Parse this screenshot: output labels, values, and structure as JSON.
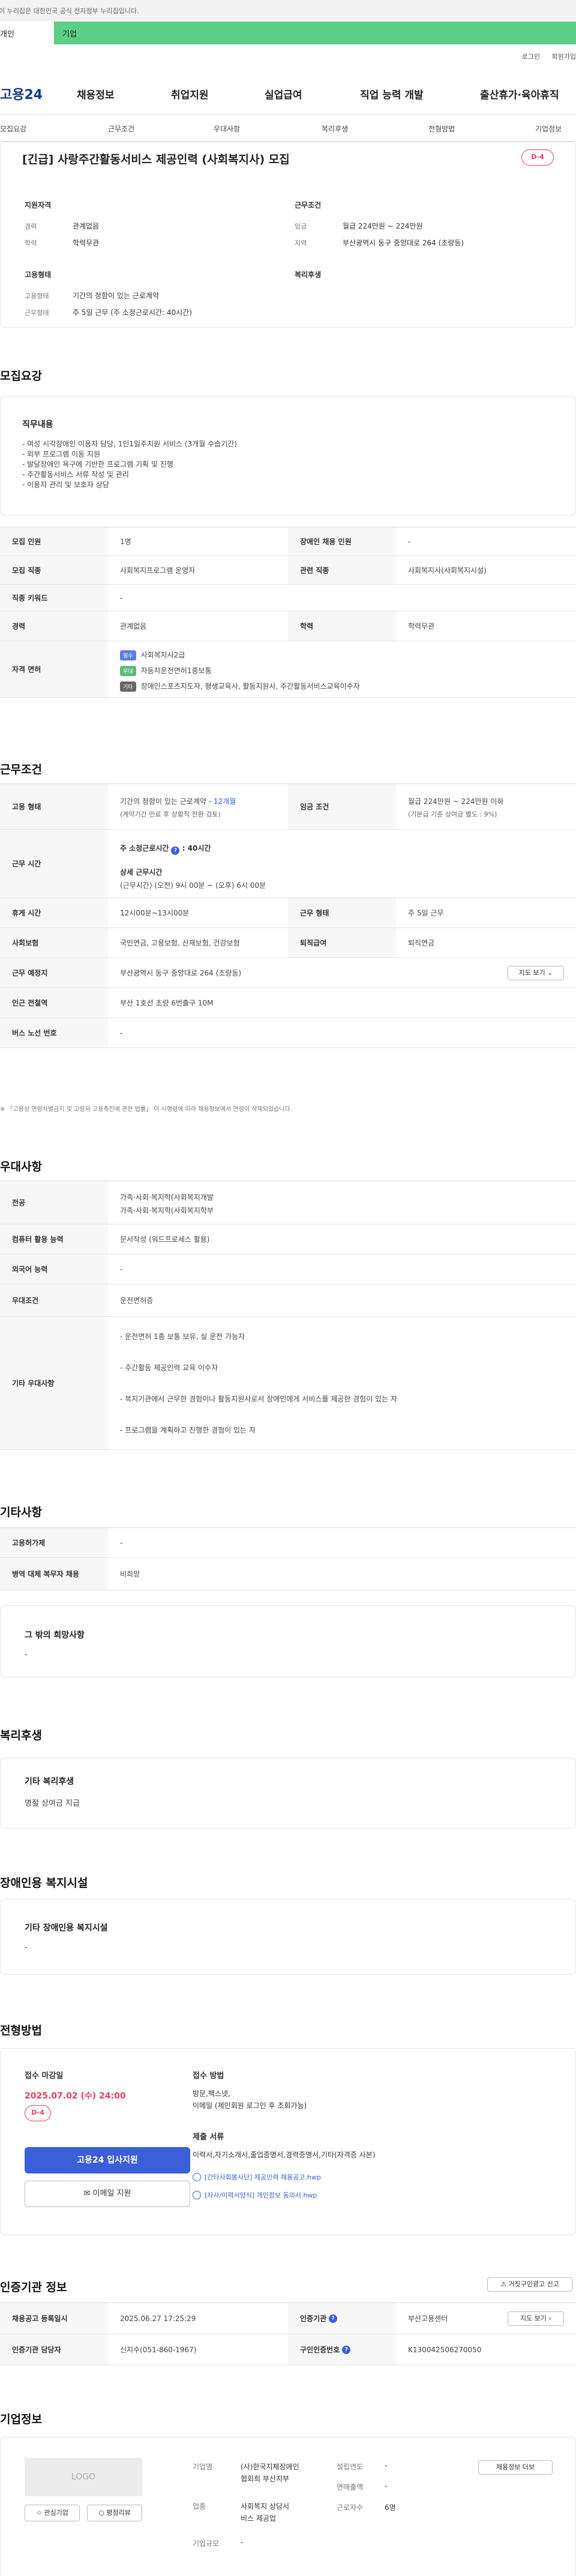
{
  "gov_banner": "이 누리집은 대한민국 공식 전자정부 누리집입니다.",
  "site_switch": {
    "personal": "개인",
    "company": "기업"
  },
  "util": {
    "login": "로그인",
    "signup": "회원가입"
  },
  "site": {
    "logo": "고용24",
    "gnb": [
      "채용정보",
      "취업지원",
      "실업급여",
      "직업 능력 개발",
      "출산휴가·육아휴직"
    ]
  },
  "subnav": [
    "모집요강",
    "근무조건",
    "우대사항",
    "복리후생",
    "전형방법",
    "기업정보"
  ],
  "summary": {
    "title": "[긴급] 사랑주간활동서비스 제공인력 (사회복지사) 모집",
    "dday": "D-4",
    "qualification": {
      "heading": "지원자격",
      "career_label": "경력",
      "career_value": "관계없음",
      "edu_label": "학력",
      "edu_value": "학력무관"
    },
    "conditions": {
      "heading": "근무조건",
      "wage_label": "임금",
      "wage_value": "월급 224만원 ~ 224만원",
      "area_label": "지역",
      "area_value": "부산광역시 동구 중앙대로 264 (초량동)"
    },
    "employment": {
      "heading": "고용형태",
      "type_label": "고용형태",
      "type_value": "기간의 정함이 있는 근로계약",
      "form_label": "근무형태",
      "form_value": "주 5일 근무 (주 소정근로시간: 40시간)"
    },
    "welfare": {
      "heading": "복리후생"
    }
  },
  "recruit": {
    "title": "모집요강",
    "duty_heading": "직무내용",
    "duty_lines": [
      "- 여성 시각장애인 이용자 담당, 1인1일주치원 서비스 (3개월 수습기간)",
      "- 외부 프로그램 이동 지원",
      "- 발달장애인 욕구에 기반한 프로그램 기획 및 진행",
      "- 주간활동서비스 서류 작성 및 관리",
      "- 이용자 관리 및 보호자 상담"
    ],
    "rows": [
      {
        "k1": "모집 인원",
        "v1": "1명",
        "k2": "장애인 채용 인원",
        "v2": "-"
      },
      {
        "k1": "모집 직종",
        "v1": "사회복지프로그램 운영자",
        "k2": "관련 직종",
        "v2": "사회복지사(사회복지시설)"
      },
      {
        "k1": "직종 키워드",
        "v1": "-"
      },
      {
        "k1": "경력",
        "v1": "관계없음",
        "k2": "학력",
        "v2": "학력무관"
      }
    ],
    "license_label": "자격 면허",
    "licenses": [
      {
        "badge": "필수",
        "badge_color": "#5b7ee5",
        "text": "사회복지사2급"
      },
      {
        "badge": "우대",
        "badge_color": "#5dbb84",
        "text": "자동차운전면허1종보통"
      },
      {
        "badge": "기타",
        "badge_color": "#666666",
        "text": "장애인스포츠지도자, 평생교육사, 활동지원사, 주간활동서비스교육이수자"
      }
    ]
  },
  "work": {
    "title": "근무조건",
    "type_label": "고용 형태",
    "type_line1_a": "기간의 정함이 있는 근로계약 - ",
    "type_line1_b": "12개월",
    "type_line2": "(계약기간 만료 후 상황직 전환 검토)",
    "wage_label": "임금 조건",
    "wage_line1": "월급 224만원 ~ 224만원 이하",
    "wage_line2": "(기본급 기준 상여금 별도 : 9%)",
    "hours_label": "근무 시간",
    "hours_weekly": "주 소정근로시간",
    "hours_weekly_value": ": 40시간",
    "hours_detail_heading": "상세 근무시간",
    "hours_detail": "(근무시간) (오전) 9시 00분 ~ (오후) 6시 00분",
    "break_label": "휴게 시간",
    "break_value": "12시00분~13시00분",
    "form_label": "근무 형태",
    "form_value": "주 5일 근무",
    "insurance_label": "사회보험",
    "insurance_value": "국민연금, 고용보험, 산재보험, 건강보험",
    "retire_label": "퇴직급여",
    "retire_value": "퇴직연금",
    "place_label": "근무 예정지",
    "place_value": "부산광역시 동구 중앙대로 264 (초량동)",
    "map_btn": "지도 보기",
    "subway_label": "인근 전철역",
    "subway_value": "부산 1호선 초량 6번출구 10M",
    "bus_label": "버스 노선 번호",
    "bus_value": "-",
    "note": "※ 「고용상 연령차별금지 및 고령자 고용촉진에 관한 법률」 이 시행령에 따라 채용정보에서 연령이 삭제되었습니다."
  },
  "prefer": {
    "title": "우대사항",
    "major_label": "전공",
    "major_lines": [
      "가족·사회·복지학(사회복지개발",
      "가족·사회·복지학(사회복지학부"
    ],
    "computer_label": "컴퓨터 활용 능력",
    "computer_value": "문서작성 (워드프로세스 활용)",
    "lang_label": "외국어 능력",
    "lang_value": "-",
    "cond_label": "우대조건",
    "cond_value": "운전면허증",
    "etc_label": "기타 우대사항",
    "etc_lines": [
      "- 운전면허 1종 보통 보유, 실 운전 가능자",
      "- 주간활동 제공인력 교육 이수자",
      "- 복지기관에서 근무한 경험이나 활동지원사로서 장애인에게 서비스를 제공한 경험이 있는 자",
      "- 프로그램을 계획하고 진행한 경험이 있는 자"
    ]
  },
  "other": {
    "title": "기타사항",
    "foreigner_label": "고용허가제",
    "foreigner_value": "-",
    "military_label": "병역 대체 복무자 채용",
    "military_value": "비희망",
    "hope_heading": "그 밖의 희망사항",
    "hope_value": "-"
  },
  "benefit": {
    "title": "복리후생",
    "heading": "기타 복리후생",
    "value": "명절 상여금 지급"
  },
  "disability": {
    "title": "장애인용 복지시설",
    "heading": "기타 장애인용 복지시설",
    "value": "-"
  },
  "selection": {
    "title": "전형방법",
    "deadline_label": "접수 마감일",
    "deadline_value": "2025.07.02 (수) 24:00",
    "dday": "D-4",
    "apply_btn": "고용24 입사지원",
    "email_btn": "이메일 지원",
    "method_heading": "접수 방법",
    "method_lines": [
      "방문,팩스넷,",
      "이메일 (제인회원 로그인 후 조회가능)"
    ],
    "docs_heading": "제출 서류",
    "docs_value": "이력서,자기소개서,졸업증명서,경력증명서,기타(자격증 사본)",
    "files": [
      "[간타사회봉사단] 제공인력 채용공고.hwp",
      "[자사/이력서양식] 개인정보 동의서.hwp"
    ]
  },
  "cert": {
    "title": "인증기관 정보",
    "report_btn": "거짓구인광고 신고",
    "date_label": "채용공고 등록일시",
    "date_value": "2025.06.27 17:25:29",
    "org_label": "인증기관",
    "org_value": "부산고용센터",
    "map_btn": "지도 보기",
    "manager_label": "인증기관 담당자",
    "manager_value": "신지수(051-860-1967)",
    "notice_label": "구인인증번호",
    "notice_value": "K130042506270050"
  },
  "company": {
    "title": "기업정보",
    "logo": "LOGO",
    "fav_btn": "관심기업",
    "rating_btn": "평점리뷰",
    "name_label": "기업명",
    "name_lines": [
      "(사)한국지체장애인",
      "협회희 부산지부"
    ],
    "industry_label": "업종",
    "industry_lines": [
      "사회복지 상담서",
      "비스 제공업"
    ],
    "scale_label": "기업규모",
    "scale_value": "-",
    "founded_label": "설립연도",
    "founded_value": "-",
    "revenue_label": "연매출액",
    "revenue_value": "-",
    "employees_label": "근로자수",
    "employees_value": "6명",
    "more_btn": "채용정보 더보"
  }
}
